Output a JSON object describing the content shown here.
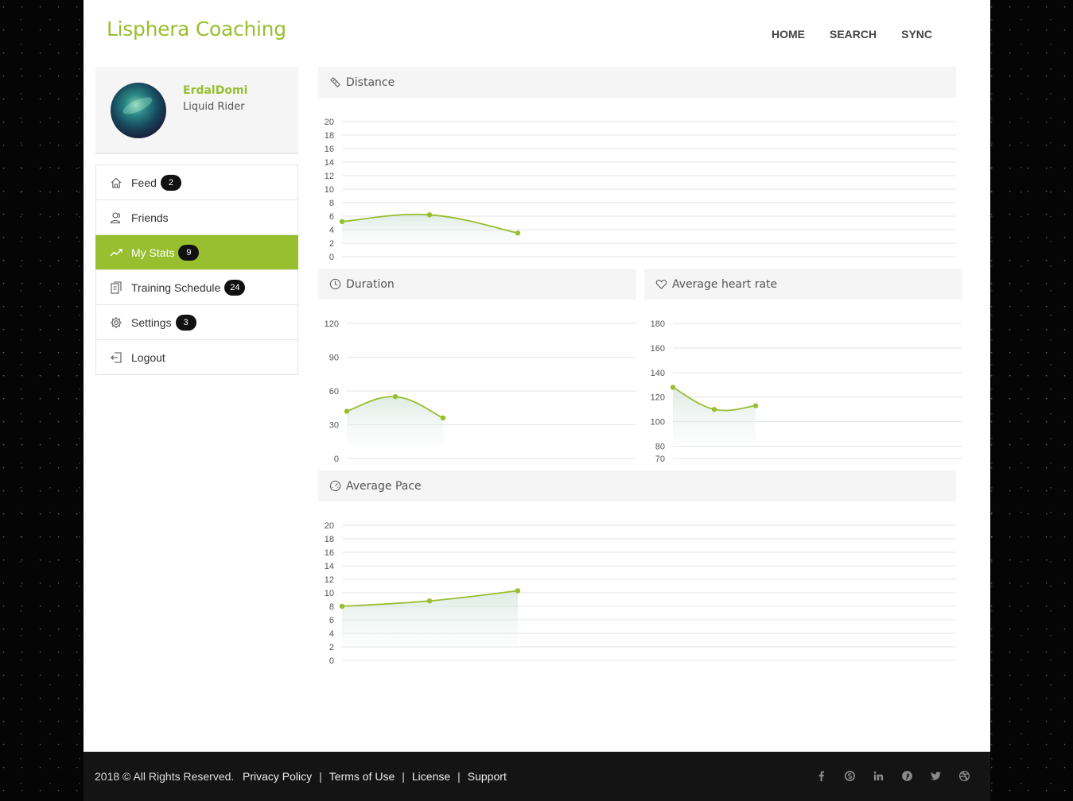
{
  "brand": "Lisphera Coaching",
  "nav": {
    "home": "HOME",
    "search": "SEARCH",
    "sync": "SYNC"
  },
  "profile": {
    "name": "ErdalDomi",
    "role": "Liquid Rider"
  },
  "menu": {
    "items": [
      {
        "label": "Feed",
        "badge": "2",
        "icon": "home-icon"
      },
      {
        "label": "Friends",
        "badge": null,
        "icon": "friends-icon"
      },
      {
        "label": "My Stats",
        "badge": "9",
        "icon": "trend-icon",
        "active": true
      },
      {
        "label": "Training Schedule",
        "badge": "24",
        "icon": "schedule-icon"
      },
      {
        "label": "Settings",
        "badge": "3",
        "icon": "gear-icon"
      },
      {
        "label": "Logout",
        "badge": null,
        "icon": "logout-icon"
      }
    ]
  },
  "accent": "#97bf2f",
  "panels": {
    "distance": "Distance",
    "duration": "Duration",
    "heart": "Average heart rate",
    "pace": "Average Pace"
  },
  "chart_data": [
    {
      "id": "distance",
      "type": "area",
      "title": "Distance",
      "ylim": [
        0,
        20
      ],
      "yticks": [
        0,
        2,
        4,
        6,
        8,
        10,
        12,
        14,
        16,
        18,
        20
      ],
      "x": [
        1,
        2,
        3
      ],
      "values": [
        5.2,
        6.2,
        3.5
      ]
    },
    {
      "id": "duration",
      "type": "area",
      "title": "Duration",
      "ylim": [
        0,
        120
      ],
      "yticks": [
        0,
        30,
        60,
        90,
        120
      ],
      "x": [
        1,
        2,
        3
      ],
      "values": [
        42,
        55,
        36
      ]
    },
    {
      "id": "heart",
      "type": "area",
      "title": "Average heart rate",
      "ylim": [
        70,
        180
      ],
      "yticks": [
        70,
        80,
        100,
        120,
        140,
        160,
        180
      ],
      "x": [
        1,
        2,
        3
      ],
      "values": [
        128,
        110,
        113
      ]
    },
    {
      "id": "pace",
      "type": "area",
      "title": "Average Pace",
      "ylim": [
        0,
        20
      ],
      "yticks": [
        0,
        2,
        4,
        6,
        8,
        10,
        12,
        14,
        16,
        18,
        20
      ],
      "x": [
        1,
        2,
        3
      ],
      "values": [
        8.0,
        8.8,
        10.3
      ]
    }
  ],
  "footer": {
    "copyright": "2018 © All Rights Reserved.",
    "links": [
      "Privacy Policy",
      "Terms of Use",
      "License",
      "Support"
    ],
    "social": [
      "facebook-icon",
      "skype-icon",
      "linkedin-icon",
      "pinterest-icon",
      "twitter-icon",
      "dribbble-icon"
    ]
  }
}
